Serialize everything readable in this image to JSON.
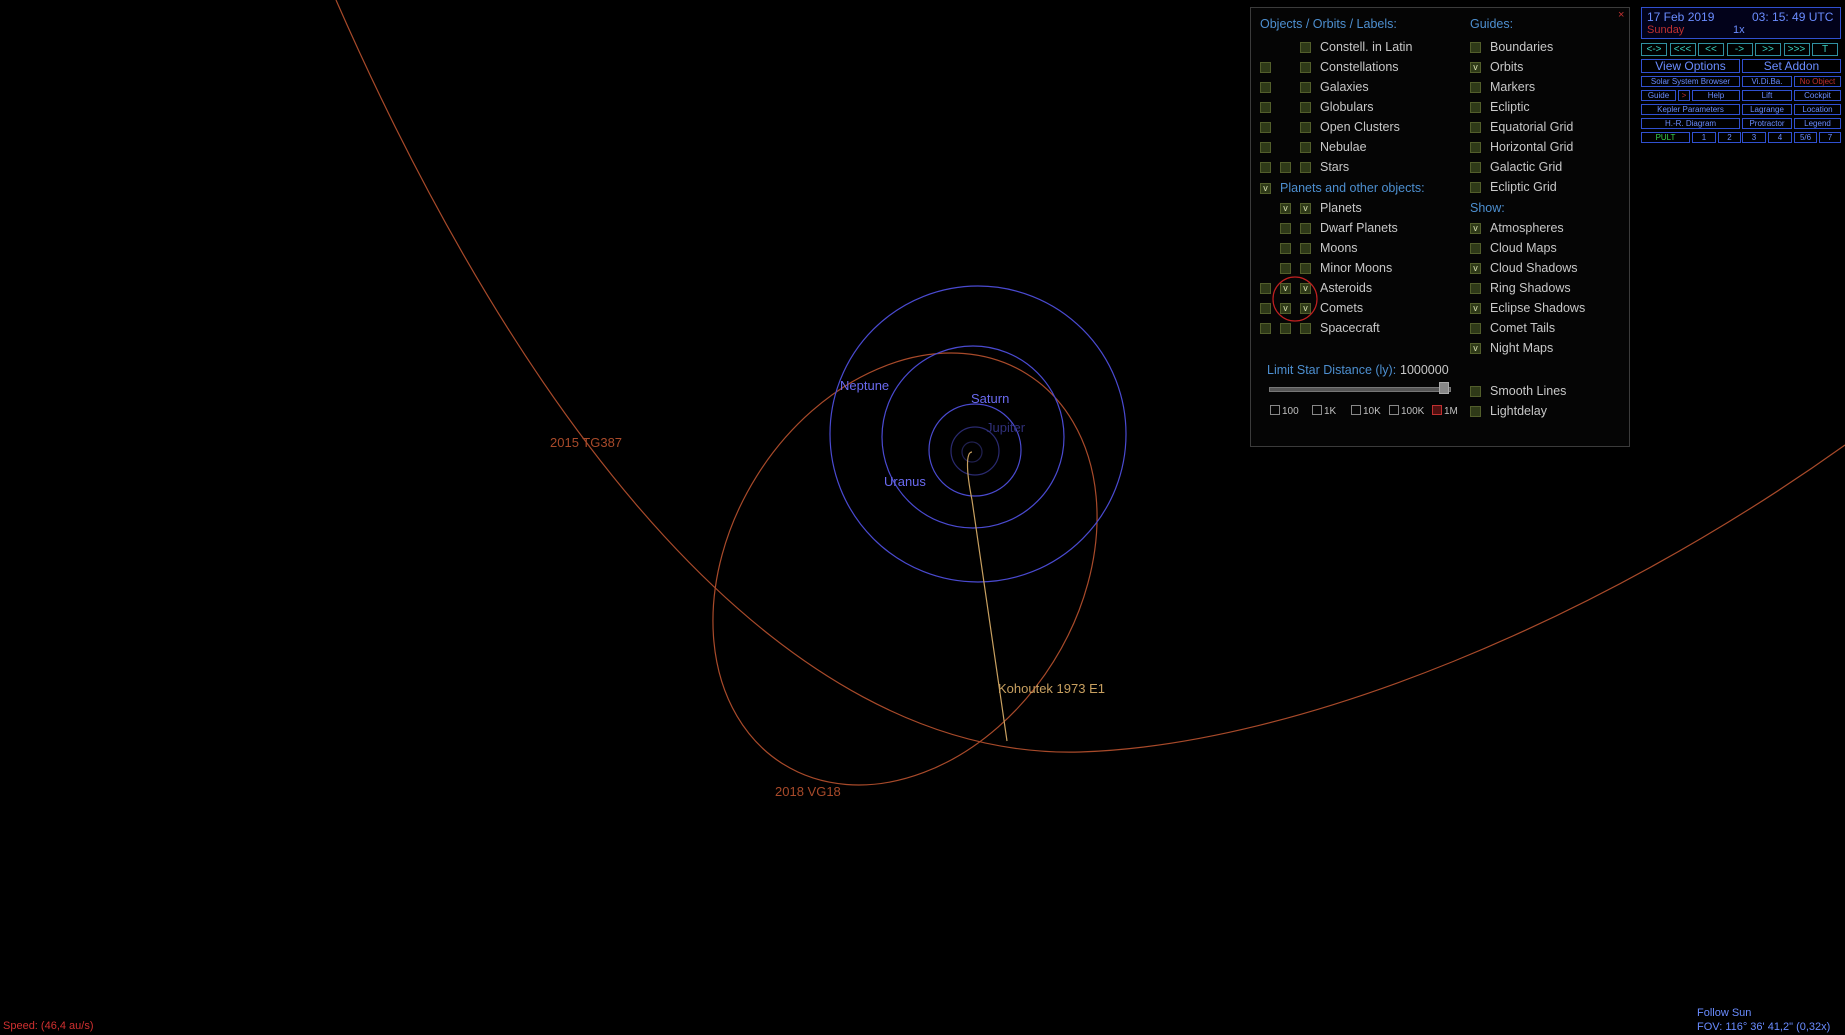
{
  "scene": {
    "orbit_labels": {
      "neptune": "Neptune",
      "saturn": "Saturn",
      "jupiter": "Jupiter",
      "uranus": "Uranus",
      "tg387": "2015 TG387",
      "vg18": "2018 VG18",
      "kohoutek": "Kohoutek 1973 E1"
    },
    "colors": {
      "planet_orbit": "#4a4ad0",
      "tno_orbit": "#a84a2a",
      "comet": "#c8a060"
    }
  },
  "speed": "Speed: (46,4 au/s)",
  "follow": "Follow Sun",
  "fov": "FOV: 116° 36' 41,2\" (0,32x)",
  "panel": {
    "objects_header": "Objects / Orbits / Labels:",
    "guides_header": "Guides:",
    "show_header": "Show:",
    "planets_header": "Planets and other objects:",
    "close": "×",
    "objects": [
      {
        "label": "Constell. in Latin",
        "c1": null,
        "c2": null,
        "c3": ""
      },
      {
        "label": "Constellations",
        "c1": "",
        "c2": null,
        "c3": ""
      },
      {
        "label": "Galaxies",
        "c1": "",
        "c2": null,
        "c3": ""
      },
      {
        "label": "Globulars",
        "c1": "",
        "c2": null,
        "c3": ""
      },
      {
        "label": "Open Clusters",
        "c1": "",
        "c2": null,
        "c3": ""
      },
      {
        "label": "Nebulae",
        "c1": "",
        "c2": null,
        "c3": ""
      },
      {
        "label": "Stars",
        "c1": "",
        "c2": "",
        "c3": ""
      }
    ],
    "planets_check": "v",
    "planet_objects": [
      {
        "label": "Planets",
        "c1": null,
        "c2": "v",
        "c3": "v"
      },
      {
        "label": "Dwarf Planets",
        "c1": null,
        "c2": "",
        "c3": ""
      },
      {
        "label": "Moons",
        "c1": null,
        "c2": "",
        "c3": ""
      },
      {
        "label": "Minor Moons",
        "c1": null,
        "c2": "",
        "c3": ""
      },
      {
        "label": "Asteroids",
        "c1": "",
        "c2": "v",
        "c3": "v"
      },
      {
        "label": "Comets",
        "c1": "",
        "c2": "v",
        "c3": "v"
      },
      {
        "label": "Spacecraft",
        "c1": "",
        "c2": "",
        "c3": ""
      }
    ],
    "guides": [
      {
        "label": "Boundaries",
        "on": ""
      },
      {
        "label": "Orbits",
        "on": "v"
      },
      {
        "label": "Markers",
        "on": ""
      },
      {
        "label": "Ecliptic",
        "on": ""
      },
      {
        "label": "Equatorial Grid",
        "on": ""
      },
      {
        "label": "Horizontal Grid",
        "on": ""
      },
      {
        "label": "Galactic Grid",
        "on": ""
      },
      {
        "label": "Ecliptic Grid",
        "on": ""
      }
    ],
    "show": [
      {
        "label": "Atmospheres",
        "on": "v"
      },
      {
        "label": "Cloud Maps",
        "on": ""
      },
      {
        "label": "Cloud Shadows",
        "on": "v"
      },
      {
        "label": "Ring Shadows",
        "on": ""
      },
      {
        "label": "Eclipse Shadows",
        "on": "v"
      },
      {
        "label": "Comet Tails",
        "on": ""
      },
      {
        "label": "Night Maps",
        "on": "v"
      }
    ],
    "extra": [
      {
        "label": "Smooth Lines",
        "on": ""
      },
      {
        "label": "Lightdelay",
        "on": ""
      }
    ],
    "limit_label": "Limit Star Distance (ly):",
    "limit_value": "1000000",
    "limit_fraction": 1.0,
    "dist_options": [
      "100",
      "1K",
      "10K",
      "100K",
      "1M"
    ],
    "dist_selected": "1M"
  },
  "control": {
    "date": "17 Feb 2019",
    "time": "03: 15: 49  UTC",
    "weekday": "Sunday",
    "rate": "1x",
    "time_buttons": [
      "<->",
      "<<<",
      "<<",
      "->",
      ">>",
      ">>>",
      "T"
    ],
    "view_options": "View Options",
    "set_addon": "Set Addon",
    "row1": [
      "Solar System Browser",
      "Vi.Di.Ba.",
      "No Object"
    ],
    "row2": [
      "Guide",
      ">",
      "Help",
      "Lift",
      "Cockpit"
    ],
    "row3": [
      "Kepler Parameters",
      "Lagrange",
      "Location"
    ],
    "row4": [
      "H.-R. Diagram",
      "Protractor",
      "Legend"
    ],
    "row5": [
      "PULT",
      "1",
      "2",
      "3",
      "4",
      "5/6",
      "7"
    ]
  }
}
